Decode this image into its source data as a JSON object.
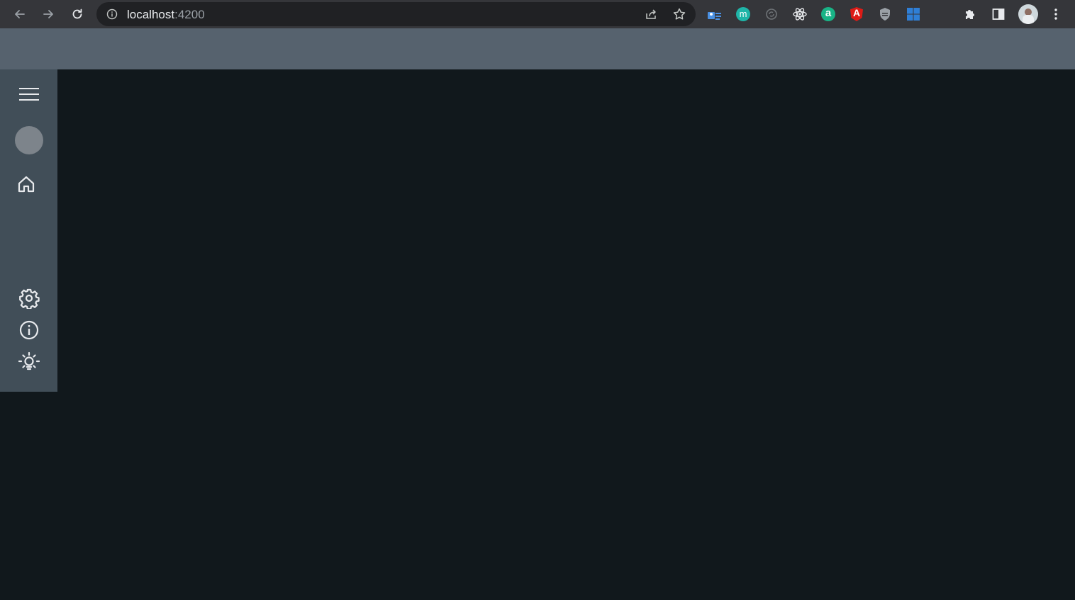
{
  "browser": {
    "url_host": "localhost",
    "url_port": ":4200",
    "icons": {
      "back": "arrow-left-icon",
      "forward": "arrow-right-icon",
      "reload": "reload-icon",
      "site_info": "info-circle-icon",
      "share": "share-icon",
      "bookmark": "star-icon",
      "extensions": "puzzle-icon",
      "side_panel": "side-panel-icon",
      "profile": "profile-avatar",
      "menu": "kebab-menu-icon"
    },
    "extensions": [
      {
        "name": "contacts-extension-icon",
        "color": "#4a90e2"
      },
      {
        "name": "m-extension-icon",
        "color": "#1fb5a8",
        "glyph": "m"
      },
      {
        "name": "sync-extension-icon",
        "color": "#7a7d80"
      },
      {
        "name": "react-devtools-icon",
        "color": "#e8eaed"
      },
      {
        "name": "a-extension-icon",
        "color": "#19b386",
        "glyph": "a"
      },
      {
        "name": "angular-devtools-icon",
        "color": "#dd1b16",
        "glyph": "A"
      },
      {
        "name": "shield-extension-icon",
        "color": "#bdc1c6"
      },
      {
        "name": "grid-extension-icon",
        "color": "#2f7fd6"
      }
    ]
  },
  "app": {
    "colors": {
      "header": "#56626e",
      "sidebar": "#414e58",
      "background": "#11181c",
      "icon": "#e8eaed"
    },
    "sidebar": {
      "items": [
        {
          "name": "menu",
          "icon": "hamburger-icon"
        },
        {
          "name": "avatar",
          "icon": "avatar"
        },
        {
          "name": "home",
          "icon": "home-icon"
        },
        {
          "name": "settings",
          "icon": "gear-icon"
        },
        {
          "name": "info",
          "icon": "info-icon"
        },
        {
          "name": "theme",
          "icon": "sun-icon"
        }
      ]
    }
  }
}
